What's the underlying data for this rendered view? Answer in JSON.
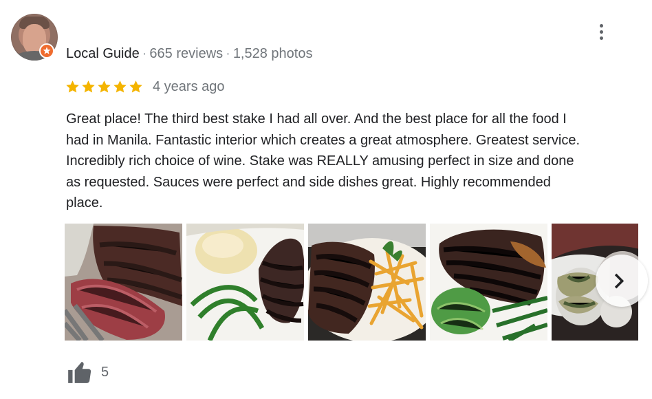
{
  "reviewer": {
    "badge_label": "Local Guide",
    "reviews": "665 reviews",
    "photos": "1,528 photos",
    "separator": "·"
  },
  "rating": {
    "stars": 5,
    "time_ago": "4 years ago",
    "star_color": "#f4b400"
  },
  "review": {
    "text": "Great place! The third best stake I had all over. And the best place for all the food I\nhad in Manila. Fantastic interior which creates a great atmosphere. Greatest service.\nIncredibly rich choice of wine. Stake was REALLY amusing perfect in size and done\nas requested. Sauces were perfect and side dishes great. Highly recommended\nplace."
  },
  "photos": [
    {
      "icon": "steak-photo"
    },
    {
      "icon": "steak-mashed-potatoes-photo"
    },
    {
      "icon": "steak-fries-photo"
    },
    {
      "icon": "steak-spinach-photo"
    },
    {
      "icon": "restaurant-table-photo"
    }
  ],
  "actions": {
    "more_icon": "more-vert-icon",
    "next_icon": "chevron-right-icon",
    "like_icon": "thumb-up-icon",
    "like_count": "5"
  },
  "colors": {
    "badge": "#ef6c2f",
    "muted_text": "#70757a",
    "primary_text": "#202124"
  }
}
